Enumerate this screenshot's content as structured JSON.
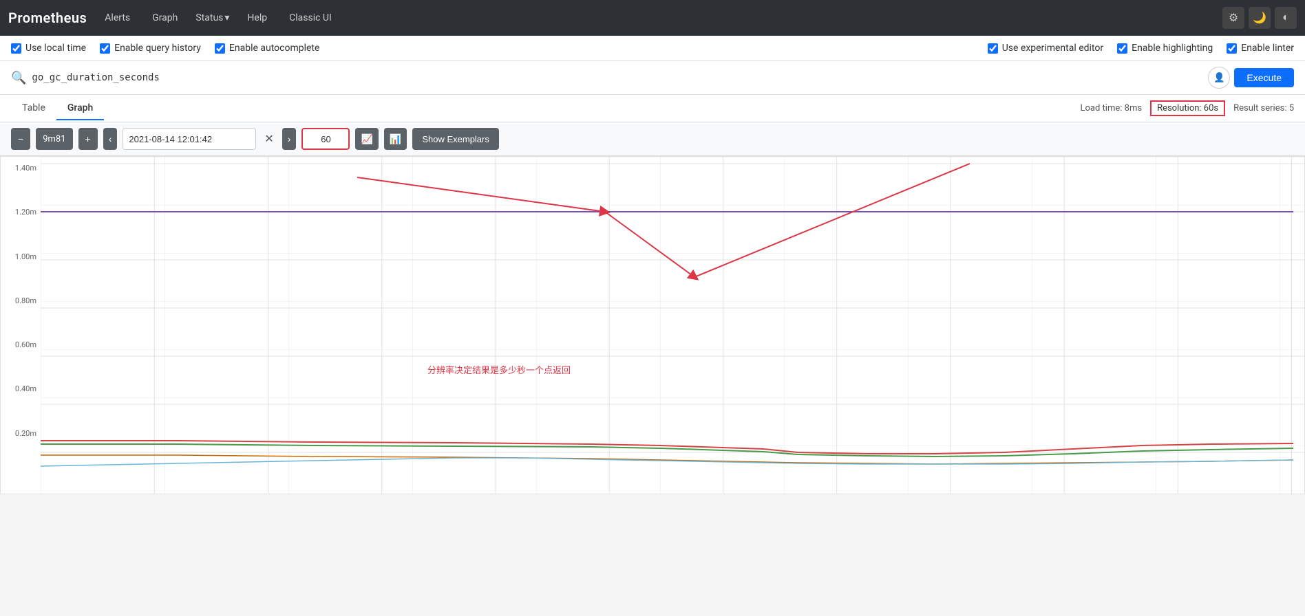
{
  "app": {
    "title": "Prometheus"
  },
  "navbar": {
    "brand": "Prometheus",
    "links": [
      "Alerts",
      "Graph",
      "Help",
      "Classic UI"
    ],
    "status_label": "Status",
    "icons": [
      "gear",
      "moon",
      "contrast"
    ]
  },
  "options": {
    "left": [
      {
        "id": "use-local-time",
        "label": "Use local time",
        "checked": true
      },
      {
        "id": "enable-query-history",
        "label": "Enable query history",
        "checked": true
      },
      {
        "id": "enable-autocomplete",
        "label": "Enable autocomplete",
        "checked": true
      }
    ],
    "right": [
      {
        "id": "use-experimental-editor",
        "label": "Use experimental editor",
        "checked": true
      },
      {
        "id": "enable-highlighting",
        "label": "Enable highlighting",
        "checked": true
      },
      {
        "id": "enable-linter",
        "label": "Enable linter",
        "checked": true
      }
    ]
  },
  "search": {
    "query": "go_gc_duration_seconds",
    "execute_label": "Execute"
  },
  "tabs": {
    "items": [
      {
        "id": "table",
        "label": "Table"
      },
      {
        "id": "graph",
        "label": "Graph"
      }
    ],
    "active": "graph",
    "meta": {
      "load_time": "Load time: 8ms",
      "resolution": "Resolution: 60s",
      "result_series": "Result series: 5"
    }
  },
  "graph_toolbar": {
    "minus_label": "−",
    "range": "9m81",
    "plus_label": "+",
    "nav_left": "‹",
    "nav_right": "›",
    "datetime": "2021-08-14 12:01:42",
    "resolution_value": "60",
    "show_exemplars_label": "Show Exemplars"
  },
  "chart": {
    "y_labels": [
      "1.40m",
      "1.20m",
      "1.00m",
      "0.80m",
      "0.60m",
      "0.40m",
      "0.20m",
      ""
    ],
    "annotation": "分辨率决定结果是多少秒一个点返回"
  }
}
